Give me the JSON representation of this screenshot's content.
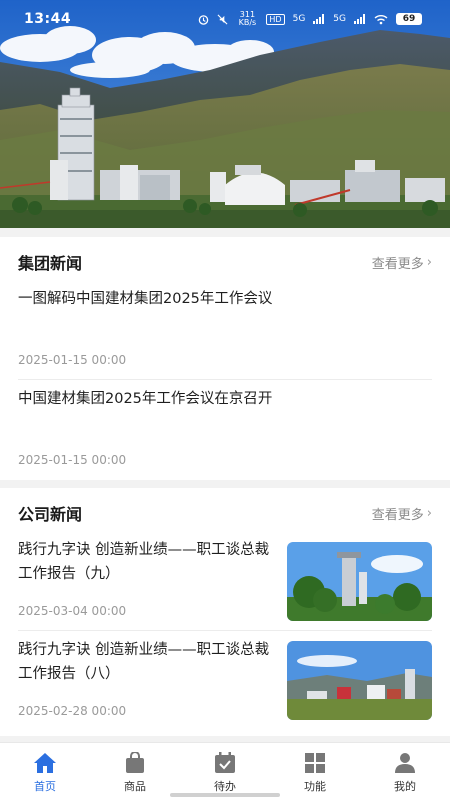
{
  "status_bar": {
    "time": "13:44",
    "network_speed": "311 KB/s",
    "hd": "HD",
    "signal1": "5G",
    "signal2": "5G",
    "battery": "69"
  },
  "group_news": {
    "title": "集团新闻",
    "more_label": "查看更多",
    "items": [
      {
        "title": "一图解码中国建材集团2025年工作会议",
        "date": "2025-01-15 00:00"
      },
      {
        "title": "中国建材集团2025年工作会议在京召开",
        "date": "2025-01-15 00:00"
      }
    ]
  },
  "company_news": {
    "title": "公司新闻",
    "more_label": "查看更多",
    "items": [
      {
        "title": "践行九字诀 创造新业绩——职工谈总裁工作报告（九）",
        "date": "2025-03-04 00:00"
      },
      {
        "title": "践行九字诀 创造新业绩——职工谈总裁工作报告（八）",
        "date": "2025-02-28 00:00"
      }
    ]
  },
  "tabbar": {
    "items": [
      {
        "label": "首页",
        "icon": "home-icon",
        "active": true
      },
      {
        "label": "商品",
        "icon": "shopping-bag-icon",
        "active": false
      },
      {
        "label": "待办",
        "icon": "todo-check-icon",
        "active": false
      },
      {
        "label": "功能",
        "icon": "grid-icon",
        "active": false
      },
      {
        "label": "我的",
        "icon": "user-icon",
        "active": false
      }
    ]
  },
  "colors": {
    "accent": "#2b6fe0",
    "text_primary": "#1f1f1f",
    "text_secondary": "#9a9a9a",
    "background": "#f2f2f2"
  }
}
